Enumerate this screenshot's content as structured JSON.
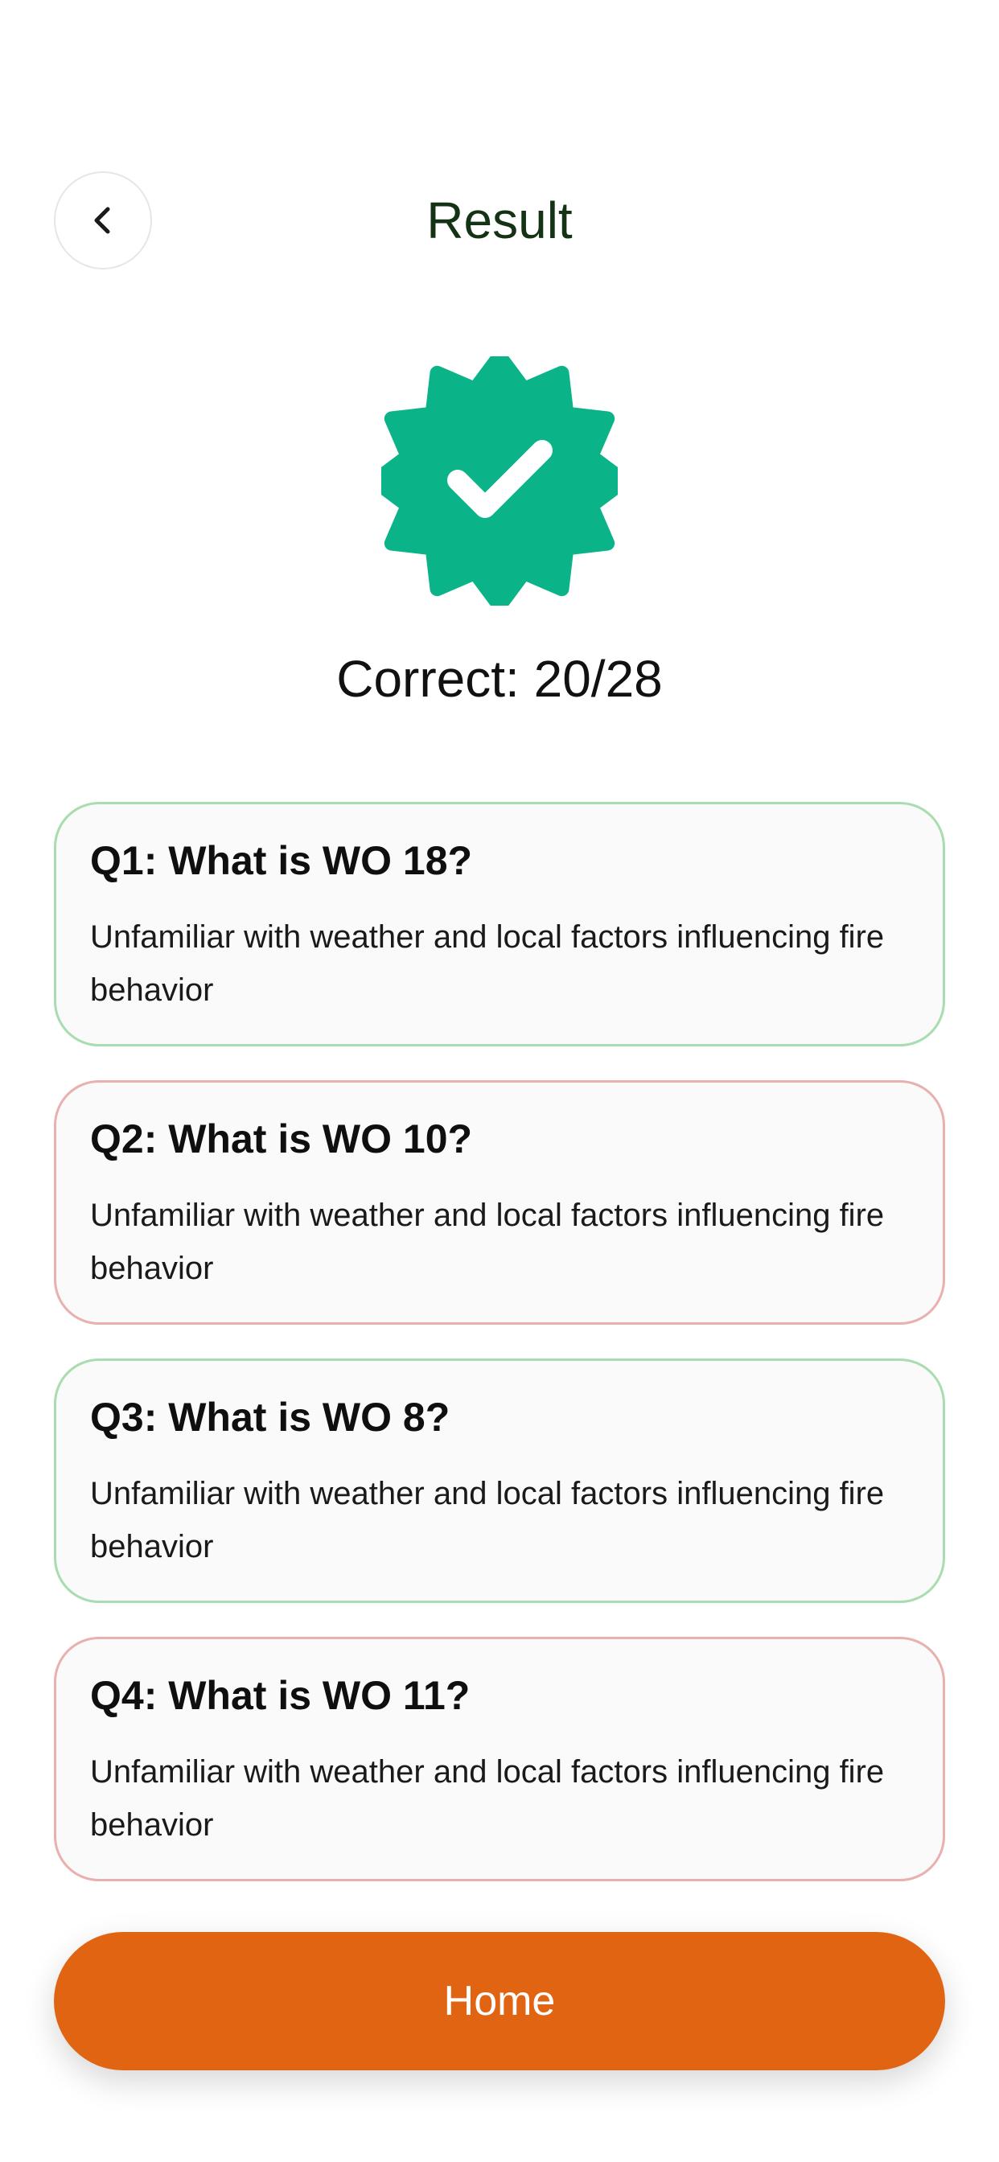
{
  "header": {
    "title": "Result",
    "back_icon": "chevron-left-icon"
  },
  "result": {
    "badge_icon": "verified-badge-icon",
    "badge_color": "#0BB488",
    "score_text": "Correct: 20/28"
  },
  "questions": [
    {
      "title": "Q1: What is WO 18?",
      "answer": "Unfamiliar with weather and local factors influencing fire behavior",
      "status": "correct"
    },
    {
      "title": "Q2: What is WO 10?",
      "answer": "Unfamiliar with weather and local factors influencing fire behavior",
      "status": "incorrect"
    },
    {
      "title": "Q3: What is WO 8?",
      "answer": "Unfamiliar with weather and local factors influencing fire behavior",
      "status": "correct"
    },
    {
      "title": "Q4: What is WO 11?",
      "answer": "Unfamiliar with weather and local factors influencing fire behavior",
      "status": "incorrect"
    }
  ],
  "colors": {
    "correct_border": "#A9DCAE",
    "incorrect_border": "#E8B0AE",
    "accent_button": "#E06412",
    "title_color": "#143314"
  },
  "footer": {
    "home_label": "Home"
  }
}
